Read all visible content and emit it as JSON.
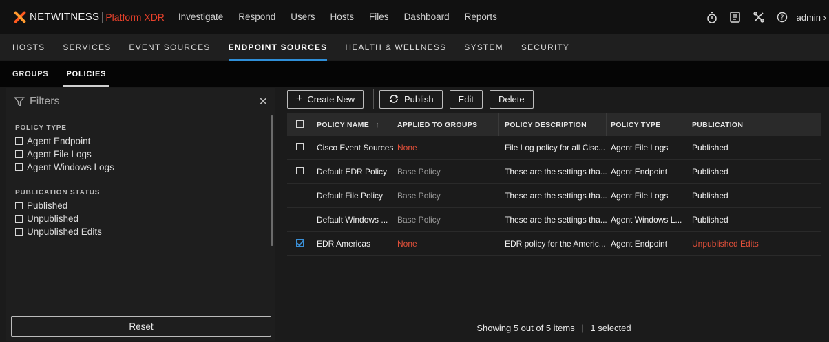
{
  "header": {
    "brand": "NETWITNESS",
    "brand_sub": "Platform XDR",
    "nav": [
      "Investigate",
      "Respond",
      "Users",
      "Hosts",
      "Files",
      "Dashboard",
      "Reports"
    ],
    "user": "admin",
    "icons": [
      "stopwatch-icon",
      "notes-icon",
      "tools-icon",
      "help-icon"
    ]
  },
  "subnav": {
    "items": [
      "HOSTS",
      "SERVICES",
      "EVENT SOURCES",
      "ENDPOINT SOURCES",
      "HEALTH & WELLNESS",
      "SYSTEM",
      "SECURITY"
    ],
    "active": "ENDPOINT SOURCES"
  },
  "tabs": {
    "items": [
      "GROUPS",
      "POLICIES"
    ],
    "active": "POLICIES"
  },
  "filters": {
    "title": "Filters",
    "policy_type_label": "POLICY TYPE",
    "policy_types": [
      "Agent Endpoint",
      "Agent File Logs",
      "Agent Windows Logs"
    ],
    "publication_status_label": "PUBLICATION STATUS",
    "publication_statuses": [
      "Published",
      "Unpublished",
      "Unpublished Edits"
    ],
    "reset_label": "Reset"
  },
  "toolbar": {
    "create_label": "Create New",
    "publish_label": "Publish",
    "edit_label": "Edit",
    "delete_label": "Delete"
  },
  "table": {
    "columns": [
      "POLICY NAME",
      "APPLIED TO GROUPS",
      "POLICY DESCRIPTION",
      "POLICY TYPE",
      "PUBLICATION _"
    ],
    "sort_indicator": "↑",
    "rows": [
      {
        "name": "Cisco Event Sources",
        "groups": "None",
        "description": "File Log policy for all Cisc...",
        "type": "Agent File Logs",
        "publication": "Published",
        "checkbox": "unchecked"
      },
      {
        "name": "Default EDR Policy",
        "groups": "Base Policy",
        "description": "These are the settings tha...",
        "type": "Agent Endpoint",
        "publication": "Published",
        "checkbox": "unchecked"
      },
      {
        "name": "Default File Policy",
        "groups": "Base Policy",
        "description": "These are the settings tha...",
        "type": "Agent File Logs",
        "publication": "Published",
        "checkbox": "none"
      },
      {
        "name": "Default Windows ...",
        "groups": "Base Policy",
        "description": "These are the settings tha...",
        "type": "Agent Windows L...",
        "publication": "Published",
        "checkbox": "none"
      },
      {
        "name": "EDR Americas",
        "groups": "None",
        "description": "EDR policy for the Americ...",
        "type": "Agent Endpoint",
        "publication": "Unpublished Edits",
        "checkbox": "checked"
      }
    ]
  },
  "footer": {
    "showing": "Showing 5 out of 5 items",
    "selected": "1 selected"
  },
  "colors": {
    "accent_blue": "#2f8fd8",
    "brand_red": "#e8412b",
    "warning_red": "#e3503a"
  }
}
